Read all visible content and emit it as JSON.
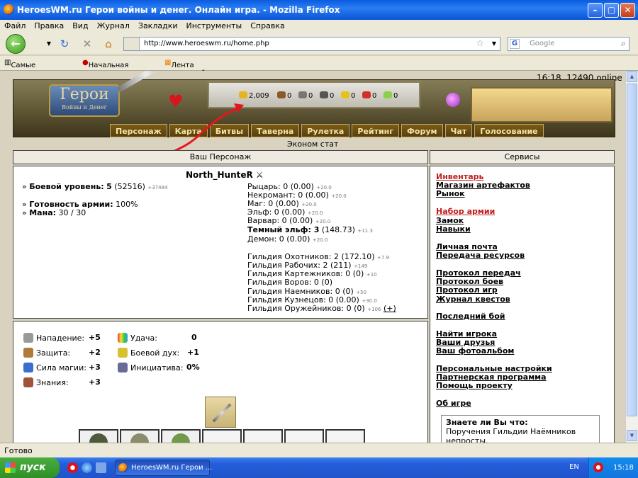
{
  "window": {
    "title": "HeroesWM.ru Герои войны и денег. Онлайн игра. - Mozilla Firefox"
  },
  "menu": [
    "Файл",
    "Правка",
    "Вид",
    "Журнал",
    "Закладки",
    "Инструменты",
    "Справка"
  ],
  "nav": {
    "url": "http://www.heroeswm.ru/home.php",
    "search_placeholder": "Google"
  },
  "bookmarks": [
    "Самые популярные",
    "Начальная страница",
    "Лента новостей"
  ],
  "header": {
    "online": "16:18, 12490 online",
    "logo_main": "Герои",
    "logo_sub": "Войны и Денег",
    "resources": [
      {
        "name": "gold",
        "value": "2,009",
        "color": "#e6b422"
      },
      {
        "name": "wood",
        "value": "0",
        "color": "#8a5a2b"
      },
      {
        "name": "ore",
        "value": "0",
        "color": "#777777"
      },
      {
        "name": "mercury",
        "value": "0",
        "color": "#555555"
      },
      {
        "name": "sulfur",
        "value": "0",
        "color": "#e5c21a"
      },
      {
        "name": "crystal",
        "value": "0",
        "color": "#d0302a"
      },
      {
        "name": "gems",
        "value": "0",
        "color": "#8bd04d"
      }
    ]
  },
  "game_nav": [
    "Персонаж",
    "Карта",
    "Битвы",
    "Таверна",
    "Рулетка",
    "Рейтинг",
    "Форум",
    "Чат",
    "Голосование"
  ],
  "econ_link": "Эконом стат",
  "character_panel": {
    "header": "Ваш Персонаж",
    "name": "North_HunteR",
    "combat_level_label": "Боевой уровень:",
    "combat_level": "5",
    "combat_exp": "(52516)",
    "combat_exp_small": "+37484",
    "army_label": "Готовность армии:",
    "army_value": "100%",
    "mana_label": "Мана:",
    "mana_value": "30 / 30",
    "factions": [
      {
        "text": "Рыцарь: 0 (0.00)",
        "small": "+20.0",
        "bold": false
      },
      {
        "text": "Некромант: 0 (0.00)",
        "small": "+20.0",
        "bold": false
      },
      {
        "text": "Маг: 0 (0.00)",
        "small": "+20.0",
        "bold": false
      },
      {
        "text": "Эльф: 0 (0.00)",
        "small": "+20.0",
        "bold": false
      },
      {
        "text": "Варвар: 0 (0.00)",
        "small": "+20.0",
        "bold": false
      },
      {
        "text": "Темный эльф: 3",
        "tail": " (148.73)",
        "small": "+11.3",
        "bold": true
      },
      {
        "text": "Демон: 0 (0.00)",
        "small": "+20.0",
        "bold": false
      }
    ],
    "guilds": [
      {
        "text": "Гильдия Охотников: 2 (172.10)",
        "small": "+7.9"
      },
      {
        "text": "Гильдия Рабочих: 2 (211)",
        "small": "+149"
      },
      {
        "text": "Гильдия Картежников: 0 (0)",
        "small": "+10"
      },
      {
        "text": "Гильдия Воров: 0 (0)",
        "small": ""
      },
      {
        "text": "Гильдия Наемников: 0 (0)",
        "small": "+50"
      },
      {
        "text": "Гильдия Кузнецов: 0 (0.00)",
        "small": "+30.0"
      },
      {
        "text": "Гильдия Оружейников: 0 (0)",
        "small": "+106",
        "extra": "(+)"
      }
    ]
  },
  "stats": [
    {
      "label": "Нападение:",
      "value": "+5",
      "color": "#9a9a9a"
    },
    {
      "label": "Защита:",
      "value": "+2",
      "color": "#b07a3a"
    },
    {
      "label": "Сила магии:",
      "value": "+3",
      "color": "#3a6fd0"
    },
    {
      "label": "Знания:",
      "value": "+3",
      "color": "#a0523a"
    },
    {
      "label": "Удача:",
      "value": "0",
      "color": "#e0a030"
    },
    {
      "label": "Боевой дух:",
      "value": "+1",
      "color": "#d8c030"
    },
    {
      "label": "Инициатива:",
      "value": "0%",
      "color": "#6a6a9a"
    }
  ],
  "services": {
    "header": "Сервисы",
    "links": [
      {
        "label": "Инвентарь",
        "red": true
      },
      {
        "label": "Магазин артефактов",
        "red": false
      },
      {
        "label": "Рынок",
        "red": false
      },
      {
        "label": "Набор армии",
        "red": true
      },
      {
        "label": "Замок",
        "red": false
      },
      {
        "label": "Навыки",
        "red": false
      },
      {
        "label": "Личная почта",
        "red": false
      },
      {
        "label": "Передача ресурсов",
        "red": false
      },
      {
        "label": "Протокол передач",
        "red": false
      },
      {
        "label": "Протокол боев",
        "red": false
      },
      {
        "label": "Протокол игр",
        "red": false
      },
      {
        "label": "Журнал квестов",
        "red": false
      },
      {
        "label": "Последний бой",
        "red": false
      },
      {
        "label": "Найти игрока",
        "red": false
      },
      {
        "label": "Ваши друзья",
        "red": false
      },
      {
        "label": "Ваш фотоальбом",
        "red": false
      },
      {
        "label": "Персональные настройки",
        "red": false
      },
      {
        "label": "Партнерская программа",
        "red": false
      },
      {
        "label": "Помощь проекту",
        "red": false
      },
      {
        "label": "Об игре",
        "red": false
      }
    ],
    "tip_title": "Знаете ли Вы что:",
    "tip_text": "Поручения Гильдии Наёмников непросты."
  },
  "status": "Готово",
  "taskbar": {
    "start": "пуск",
    "task": "HeroesWM.ru Герои ...",
    "lang": "EN",
    "time": "15:18"
  }
}
